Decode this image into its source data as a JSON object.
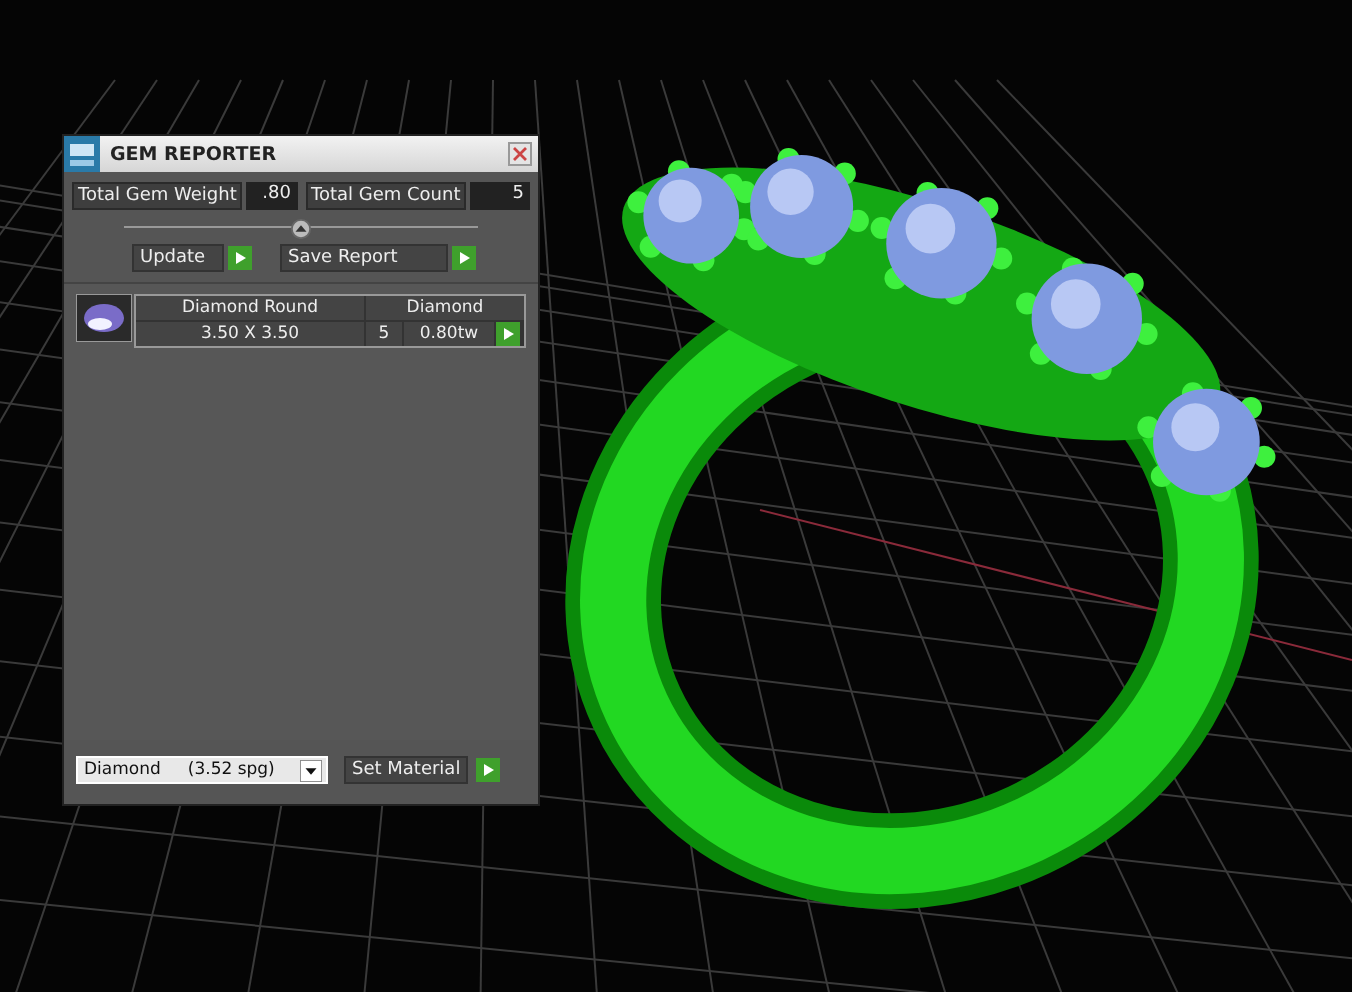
{
  "window": {
    "title": "GEM REPORTER"
  },
  "totals": [
    {
      "label": "Total Gem Weight",
      "value": ".80"
    },
    {
      "label": "Total Gem Count",
      "value": "5"
    }
  ],
  "actions": [
    {
      "label": "Update"
    },
    {
      "label": "Save Report"
    }
  ],
  "gems": [
    {
      "name": "Diamond Round",
      "material": "Diamond",
      "size": "3.50 X 3.50",
      "count": "5",
      "weight": "0.80tw"
    }
  ],
  "material_select": {
    "value": "Diamond     (3.52 spg)"
  },
  "set_button": "Set Material"
}
